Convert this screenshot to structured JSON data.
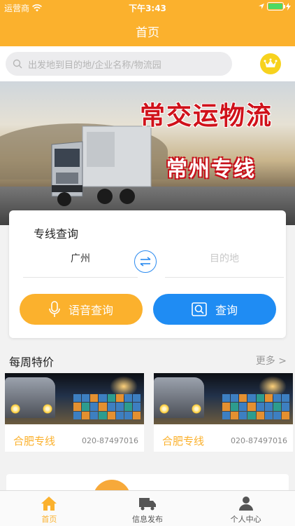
{
  "colors": {
    "accent": "#fbb12d",
    "primary_blue": "#1f8cf3"
  },
  "status_bar": {
    "carrier": "运营商",
    "time": "下午3:43"
  },
  "nav": {
    "title": "首页"
  },
  "search": {
    "placeholder": "出发地到目的地/企业名称/物流园",
    "icon": "search-icon"
  },
  "vip": {
    "icon": "crown-icon"
  },
  "banner": {
    "line1": "常交运物流",
    "line2": "常州专线"
  },
  "query": {
    "title": "专线查询",
    "from_value": "广州",
    "to_placeholder": "目的地",
    "voice_label": "语音查询",
    "search_label": "查询"
  },
  "weekly": {
    "title": "每周特价",
    "more": "更多 >",
    "items": [
      {
        "route": "合肥专线",
        "phone": "020-87497016"
      },
      {
        "route": "合肥专线",
        "phone": "020-87497016"
      }
    ]
  },
  "tabs": [
    {
      "label": "首页",
      "icon": "home-icon",
      "active": true
    },
    {
      "label": "信息发布",
      "icon": "truck-icon",
      "active": false
    },
    {
      "label": "个人中心",
      "icon": "person-icon",
      "active": false
    }
  ]
}
